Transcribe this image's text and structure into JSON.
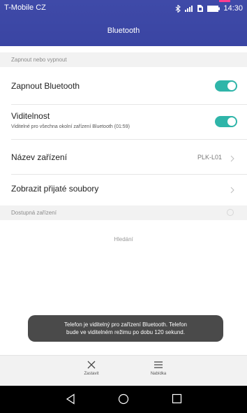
{
  "status": {
    "carrier": "T-Mobile CZ",
    "time": "14:30",
    "icons": [
      "bluetooth-icon",
      "signal-icon",
      "sim-icon",
      "battery-icon"
    ]
  },
  "header": {
    "title": "Bluetooth"
  },
  "sections": {
    "toggle_header": "Zapnout nebo vypnout",
    "devices_header": "Dostupná zařízení"
  },
  "rows": {
    "bluetooth": {
      "label": "Zapnout Bluetooth",
      "enabled": true
    },
    "visibility": {
      "label": "Viditelnost",
      "sub": "Viditelné pro všechna okolní zařízení Bluetooth (01:59)",
      "enabled": true
    },
    "device_name": {
      "label": "Název zařízení",
      "value": "PLK-L01"
    },
    "received_files": {
      "label": "Zobrazit přijaté soubory"
    }
  },
  "searching": "Hledání",
  "toast": {
    "line1": "Telefon je viditelný pro zařízení Bluetooth. Telefon",
    "line2": "bude ve viditelném režimu po dobu 120 sekund."
  },
  "bottom": {
    "stop_label": "Zastavit",
    "menu_label": "Nabídka"
  },
  "colors": {
    "header": "#3f4aa8",
    "toggle_on": "#2fb5a9",
    "toast_bg": "#4a4a4a"
  }
}
